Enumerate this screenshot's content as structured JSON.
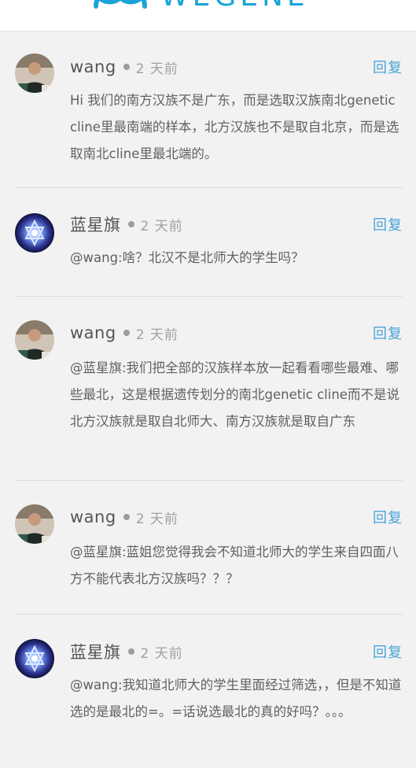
{
  "brand": {
    "logo_text": "WEGENE",
    "color": "#1aa3d8"
  },
  "reply_color": "#4aa3d6",
  "comments": [
    {
      "author": "wang",
      "avatar": "photo-avatar",
      "time": "2 天前",
      "reply_label": "回复",
      "text": "Hi 我们的南方汉族不是广东，而是选取汉族南北genetic cline里最南端的样本，北方汉族也不是取自北京，而是选取南北cline里最北端的。"
    },
    {
      "author": "蓝星旗",
      "avatar": "star-avatar",
      "time": "2 天前",
      "reply_label": "回复",
      "text": "@wang:啥？北汉不是北师大的学生吗？"
    },
    {
      "author": "wang",
      "avatar": "photo-avatar",
      "time": "2 天前",
      "reply_label": "回复",
      "text": "@蓝星旗:我们把全部的汉族样本放一起看看哪些最难、哪些最北，这是根据遗传划分的南北genetic cline而不是说北方汉族就是取自北师大、南方汉族就是取自广东"
    },
    {
      "author": "wang",
      "avatar": "photo-avatar",
      "time": "2 天前",
      "reply_label": "回复",
      "text": "@蓝星旗:蓝姐您觉得我会不知道北师大的学生来自四面八方不能代表北方汉族吗？？？"
    },
    {
      "author": "蓝星旗",
      "avatar": "star-avatar",
      "time": "2 天前",
      "reply_label": "回复",
      "text": "@wang:我知道北师大的学生里面经过筛选，，但是不知道选的是最北的=。=话说选最北的真的好吗？。。。"
    }
  ]
}
